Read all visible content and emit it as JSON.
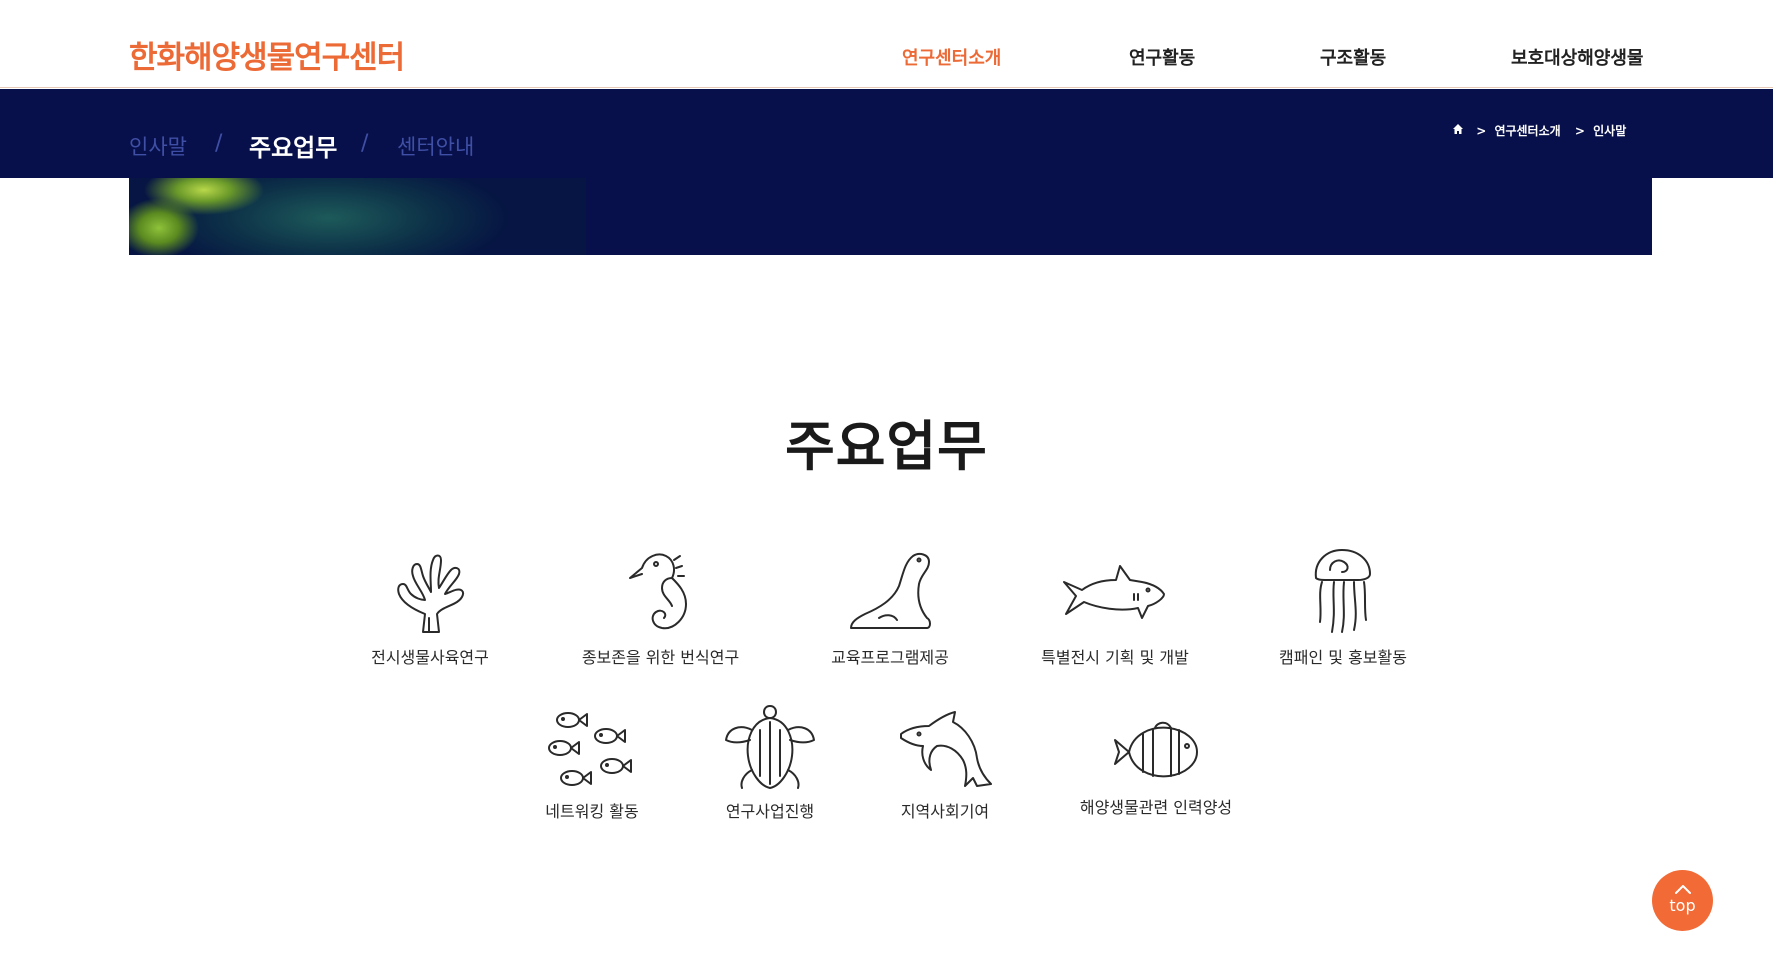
{
  "header": {
    "logo": "한화해양생물연구센터",
    "nav": [
      {
        "label": "연구센터소개",
        "active": true
      },
      {
        "label": "연구활동",
        "active": false
      },
      {
        "label": "구조활동",
        "active": false
      },
      {
        "label": "보호대상해양생물",
        "active": false
      }
    ]
  },
  "subnav": {
    "tabs": [
      {
        "label": "인사말"
      },
      {
        "label": "주요업무"
      },
      {
        "label": "센터안내"
      }
    ],
    "separator": "/",
    "breadcrumb": {
      "home_icon": "home-icon",
      "arrow": ">",
      "items": [
        "연구센터소개",
        "인사말"
      ]
    }
  },
  "main": {
    "title": "주요업무",
    "works": [
      {
        "label": "전시생물사육연구",
        "icon": "coral-icon"
      },
      {
        "label": "종보존을 위한 번식연구",
        "icon": "seahorse-icon"
      },
      {
        "label": "교육프로그램제공",
        "icon": "seal-icon"
      },
      {
        "label": "특별전시 기획 및 개발",
        "icon": "shark-icon"
      },
      {
        "label": "캠패인 및 홍보활동",
        "icon": "jellyfish-icon"
      },
      {
        "label": "네트워킹 활동",
        "icon": "fish-school-icon"
      },
      {
        "label": "연구사업진행",
        "icon": "turtle-icon"
      },
      {
        "label": "지역사회기여",
        "icon": "dolphin-icon"
      },
      {
        "label": "해양생물관련 인력양성",
        "icon": "clownfish-icon"
      }
    ]
  },
  "top_button": {
    "label": "top"
  },
  "colors": {
    "accent": "#ec6a36",
    "navy": "#07104a",
    "tab_inactive": "#3f4fa6"
  }
}
